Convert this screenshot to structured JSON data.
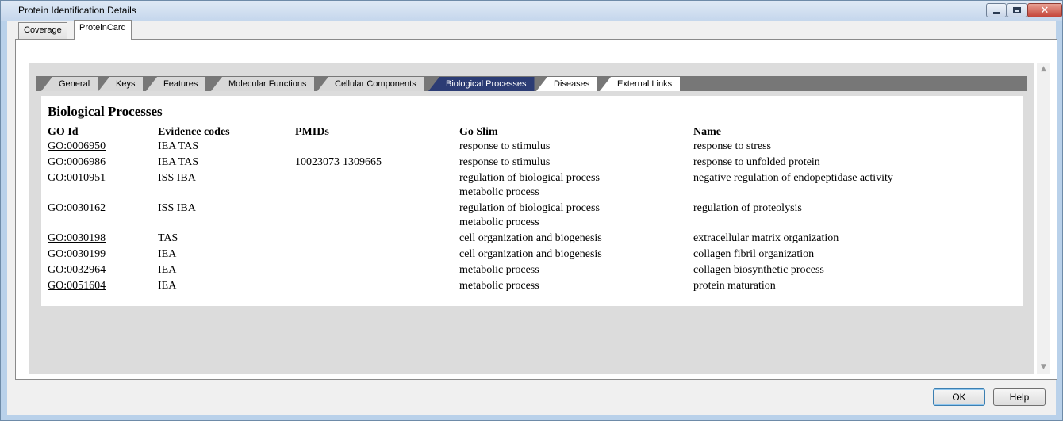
{
  "window": {
    "title": "Protein Identification Details"
  },
  "outer_tabs": [
    "Coverage",
    "ProteinCard"
  ],
  "inner_tabs": [
    "General",
    "Keys",
    "Features",
    "Molecular Functions",
    "Cellular Components",
    "Biological Processes",
    "Diseases",
    "External Links"
  ],
  "section_title": "Biological Processes",
  "columns": {
    "go_id": "GO Id",
    "evidence": "Evidence codes",
    "pmids": "PMIDs",
    "go_slim": "Go Slim",
    "name": "Name"
  },
  "rows": [
    {
      "go_id": "GO:0006950",
      "evidence": "IEA TAS",
      "pmids": [],
      "go_slim": [
        "response to stimulus"
      ],
      "name": "response to stress"
    },
    {
      "go_id": "GO:0006986",
      "evidence": "IEA TAS",
      "pmids": [
        "10023073",
        "1309665"
      ],
      "go_slim": [
        "response to stimulus"
      ],
      "name": "response to unfolded protein"
    },
    {
      "go_id": "GO:0010951",
      "evidence": "ISS IBA",
      "pmids": [],
      "go_slim": [
        "regulation of biological process",
        "metabolic process"
      ],
      "name": "negative regulation of endopeptidase activity"
    },
    {
      "go_id": "GO:0030162",
      "evidence": "ISS IBA",
      "pmids": [],
      "go_slim": [
        "regulation of biological process",
        "metabolic process"
      ],
      "name": "regulation of proteolysis"
    },
    {
      "go_id": "GO:0030198",
      "evidence": "TAS",
      "pmids": [],
      "go_slim": [
        "cell organization and biogenesis"
      ],
      "name": "extracellular matrix organization"
    },
    {
      "go_id": "GO:0030199",
      "evidence": "IEA",
      "pmids": [],
      "go_slim": [
        "cell organization and biogenesis"
      ],
      "name": "collagen fibril organization"
    },
    {
      "go_id": "GO:0032964",
      "evidence": "IEA",
      "pmids": [],
      "go_slim": [
        "metabolic process"
      ],
      "name": "collagen biosynthetic process"
    },
    {
      "go_id": "GO:0051604",
      "evidence": "IEA",
      "pmids": [],
      "go_slim": [
        "metabolic process"
      ],
      "name": "protein maturation"
    }
  ],
  "buttons": {
    "ok": "OK",
    "help": "Help"
  },
  "icons": {
    "minimize": "minimize-icon",
    "maximize": "maximize-icon",
    "close": "close-icon",
    "scroll_up": "scroll-up-arrow-icon",
    "scroll_down": "scroll-down-arrow-icon"
  },
  "colors": {
    "active_tab": "#2c3c74",
    "tab_strip": "#777777",
    "content_bg": "#dcdcdc"
  }
}
